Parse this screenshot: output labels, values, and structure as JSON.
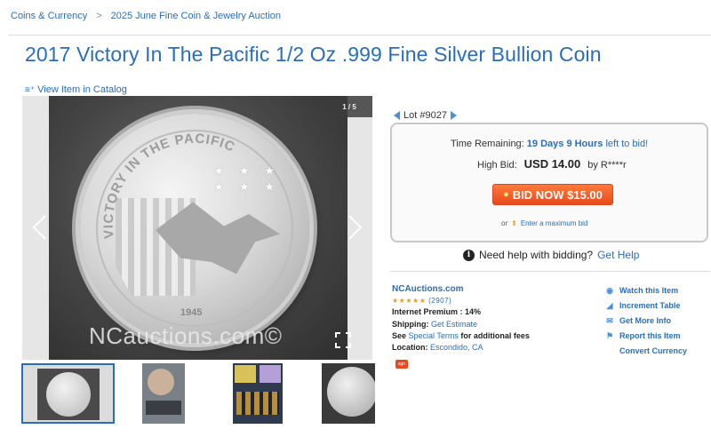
{
  "breadcrumb": {
    "items": [
      "Coins & Currency",
      "2025 June Fine Coin & Jewelry Auction"
    ],
    "separator": ">"
  },
  "page_title": "2017 Victory In The Pacific 1/2 Oz .999 Fine Silver Bullion Coin",
  "catalog_link": "View Item in Catalog",
  "gallery": {
    "counter": "1 / 5",
    "watermark": "NCauctions.com©",
    "coin_year": "1945",
    "coin_legend": "VICTORY IN THE PACIFIC",
    "thumbnail_count": 4,
    "selected_index": 0
  },
  "lot": {
    "label": "Lot #9027"
  },
  "bid": {
    "time_label": "Time Remaining:",
    "time_value": "19 Days 9 Hours",
    "time_suffix": "left to bid!",
    "high_bid_label": "High Bid:",
    "high_bid_amount": "USD 14.00",
    "high_bid_by": "by R****r",
    "button_label": "BID NOW $15.00",
    "max_bid_prefix": "or",
    "max_bid_link": "Enter a maximum bid"
  },
  "help": {
    "text": "Need help with bidding?",
    "link": "Get Help"
  },
  "seller": {
    "name": "NCAuctions.com",
    "stars": "★★★★★",
    "rating_count": "(2907)",
    "premium_label": "Internet Premium :",
    "premium_value": "14%",
    "shipping_label": "Shipping:",
    "shipping_link": "Get Estimate",
    "terms_prefix": "See",
    "terms_link": "Special Terms",
    "terms_suffix": "for additional fees",
    "location_label": "Location:",
    "location_value": "Escondido, CA",
    "badge": "sgn"
  },
  "actions": [
    "Watch this Item",
    "Increment Table",
    "Get More Info",
    "Report this Item",
    "Convert Currency"
  ],
  "colors": {
    "link_blue": "#2a6ebb",
    "bid_orange": "#e8491c",
    "star_gold": "#e8a11c"
  }
}
